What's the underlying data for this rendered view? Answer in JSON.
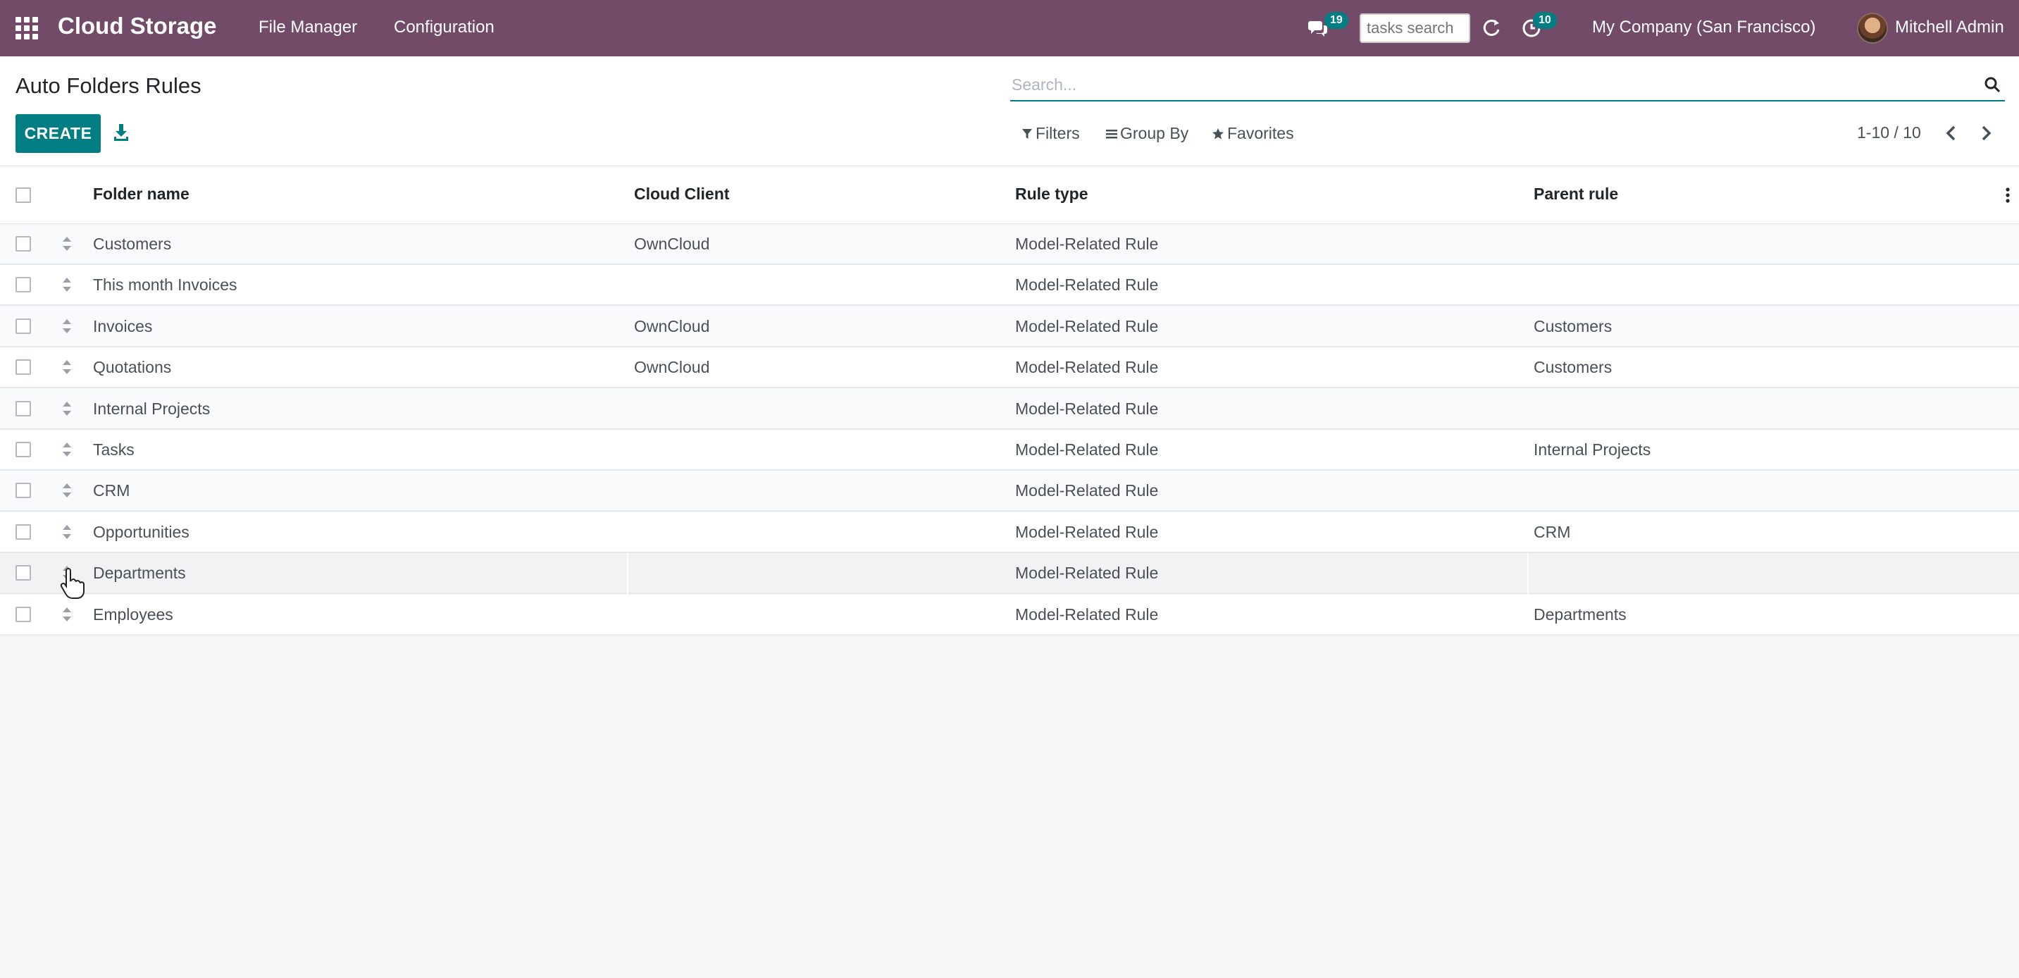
{
  "navbar": {
    "brand": "Cloud Storage",
    "menu": [
      "File Manager",
      "Configuration"
    ],
    "messages_badge": "19",
    "tasks_search_placeholder": "tasks search",
    "activities_badge": "10",
    "company": "My Company (San Francisco)",
    "user": "Mitchell Admin"
  },
  "control_panel": {
    "title": "Auto Folders Rules",
    "create_label": "CREATE",
    "search_placeholder": "Search...",
    "filters_label": "Filters",
    "group_by_label": "Group By",
    "favorites_label": "Favorites",
    "pager": "1-10 / 10"
  },
  "table": {
    "columns": [
      "Folder name",
      "Cloud Client",
      "Rule type",
      "Parent rule"
    ],
    "rows": [
      {
        "folder": "Customers",
        "client": "OwnCloud",
        "type": "Model-Related Rule",
        "parent": ""
      },
      {
        "folder": "This month Invoices",
        "client": "",
        "type": "Model-Related Rule",
        "parent": ""
      },
      {
        "folder": "Invoices",
        "client": "OwnCloud",
        "type": "Model-Related Rule",
        "parent": "Customers"
      },
      {
        "folder": "Quotations",
        "client": "OwnCloud",
        "type": "Model-Related Rule",
        "parent": "Customers"
      },
      {
        "folder": "Internal Projects",
        "client": "",
        "type": "Model-Related Rule",
        "parent": ""
      },
      {
        "folder": "Tasks",
        "client": "",
        "type": "Model-Related Rule",
        "parent": "Internal Projects"
      },
      {
        "folder": "CRM",
        "client": "",
        "type": "Model-Related Rule",
        "parent": ""
      },
      {
        "folder": "Opportunities",
        "client": "",
        "type": "Model-Related Rule",
        "parent": "CRM"
      },
      {
        "folder": "Departments",
        "client": "",
        "type": "Model-Related Rule",
        "parent": ""
      },
      {
        "folder": "Employees",
        "client": "",
        "type": "Model-Related Rule",
        "parent": "Departments"
      }
    ]
  },
  "colors": {
    "navbar": "#714B67",
    "accent": "#017e84"
  }
}
